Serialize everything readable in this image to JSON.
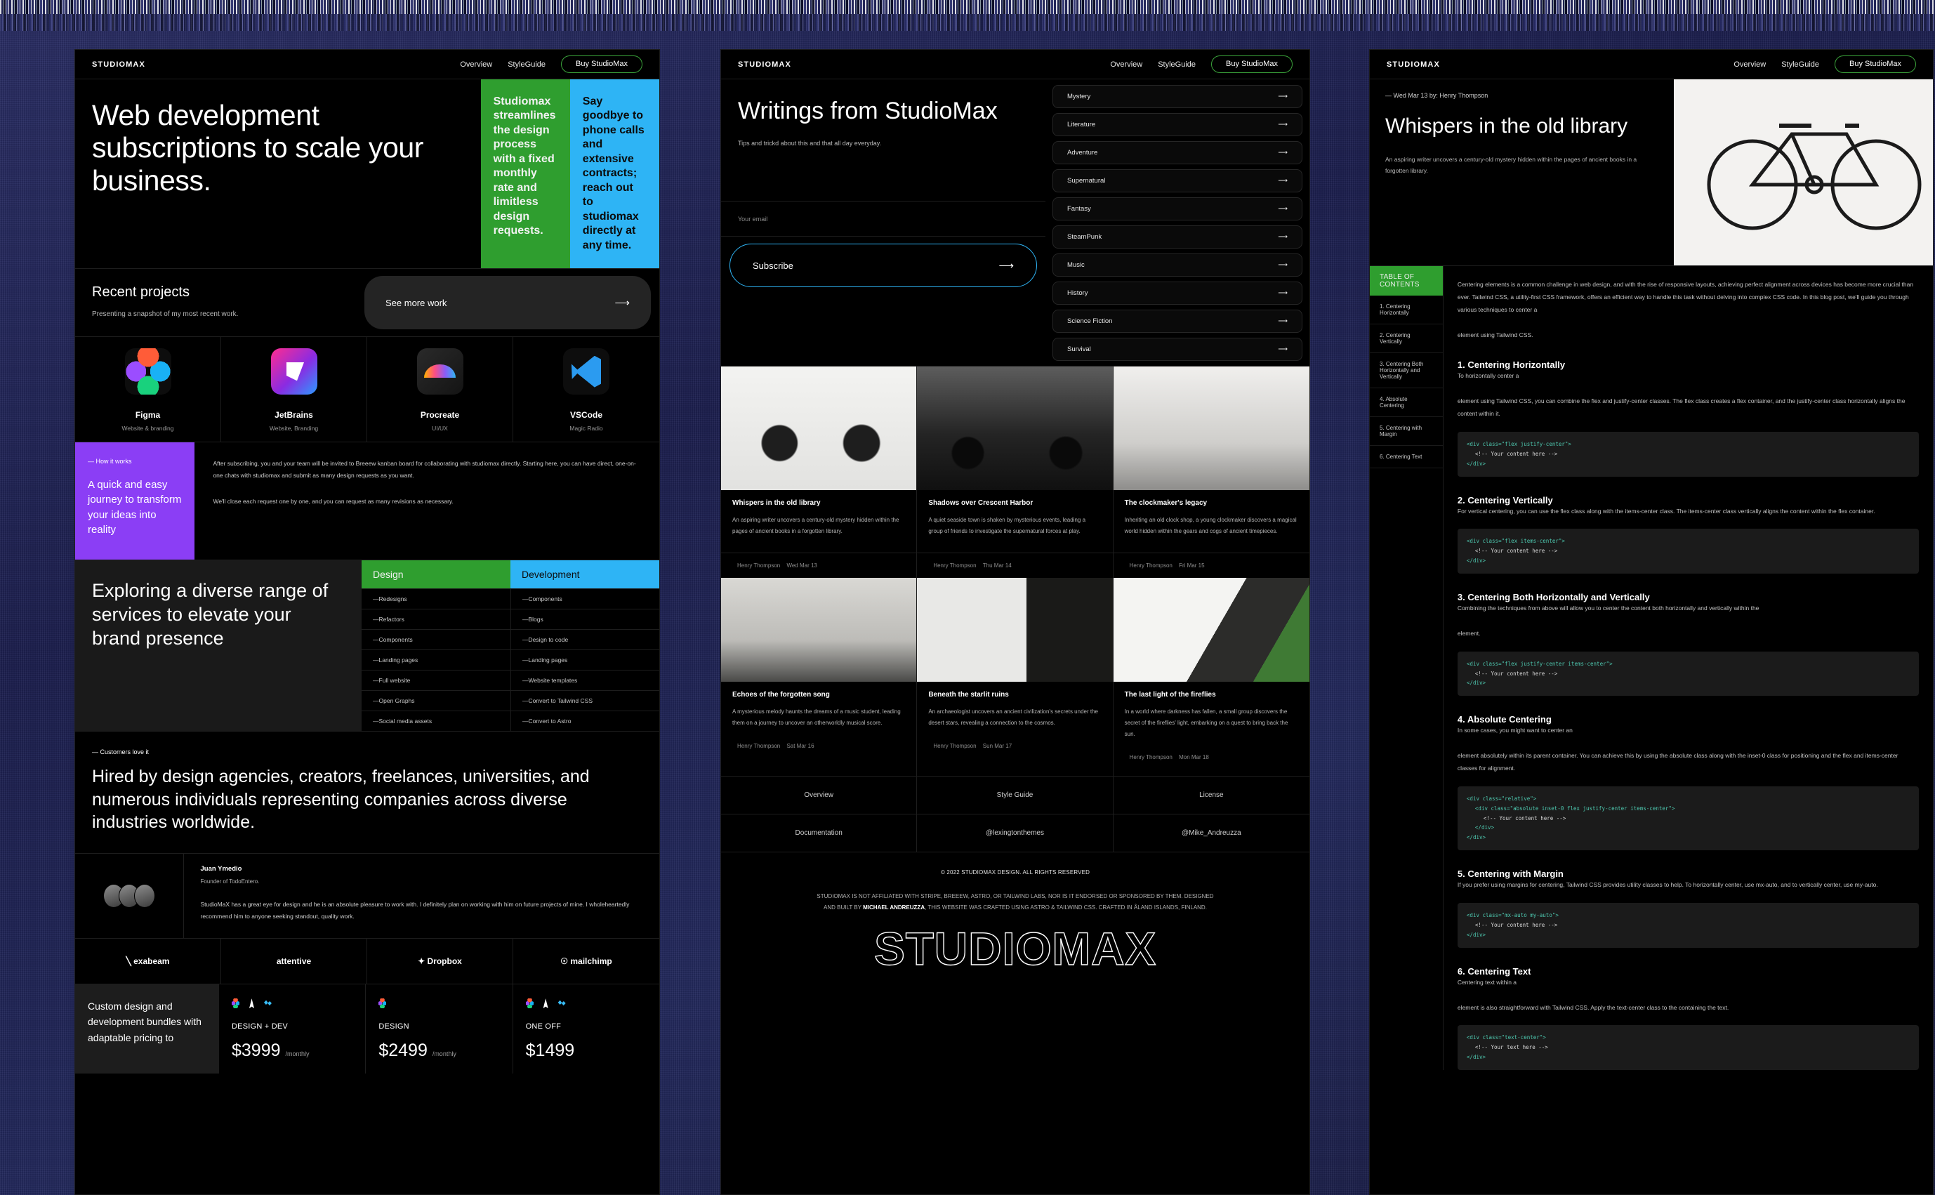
{
  "nav": {
    "brand": "STUDIOMAX",
    "links": [
      "Overview",
      "StyleGuide"
    ],
    "cta": "Buy StudioMax",
    "cta_color": "#3aa33a"
  },
  "panel1": {
    "hero": {
      "title": "Web development subscriptions to scale your business.",
      "card_green": "Studiomax streamlines the design process with a fixed monthly rate and limitless design requests.",
      "card_blue": "Say goodbye to phone calls and extensive contracts; reach out to studiomax directly at any time.",
      "green": "#2f9e2f",
      "blue": "#2eb4f5"
    },
    "recent": {
      "heading": "Recent projects",
      "sub": "Presenting a snapshot of my most recent work.",
      "cta": "See more work",
      "apps": [
        {
          "name": "Figma",
          "desc": "Website & branding",
          "icon": "figma-icon"
        },
        {
          "name": "JetBrains",
          "desc": "Website, Branding",
          "icon": "jetbrains-icon"
        },
        {
          "name": "Procreate",
          "desc": "UI/UX",
          "icon": "procreate-icon"
        },
        {
          "name": "VSCode",
          "desc": "Magic Radio",
          "icon": "vscode-icon"
        }
      ]
    },
    "how": {
      "eyebrow": "— How it works",
      "title": "A quick and easy journey to transform your ideas into reality",
      "purple": "#8b3ef5",
      "paragraphs": [
        "After subscribing, you and your team will be invited to Breeew kanban board for collaborating with studiomax directly. Starting here, you can have direct, one-on-one chats with studiomax and submit as many design requests as you want.",
        "We'll close each request one by one, and you can request as many revisions as necessary."
      ]
    },
    "services": {
      "title": "Exploring a diverse range of services to elevate your brand presence",
      "col_design": "Design",
      "col_development": "Development",
      "design_items": [
        "—Redesigns",
        "—Refactors",
        "—Components",
        "—Landing pages",
        "—Full website",
        "—Open Graphs",
        "—Social media assets"
      ],
      "dev_items": [
        "—Components",
        "—Blogs",
        "—Design to code",
        "—Landing pages",
        "—Website templates",
        "—Convert to Tailwind CSS",
        "—Convert to Astro"
      ]
    },
    "customers": {
      "eyebrow": "— Customers love it",
      "title": "Hired by design agencies, creators, freelances, universities, and numerous individuals representing companies across diverse industries worldwide."
    },
    "testimonial": {
      "name": "Juan Ymedio",
      "role": "Founder of TodoEntero.",
      "quote": "StudioMaX has a great eye for design and he is an absolute pleasure to work with. I definitely plan on working with him on future projects of mine. I wholeheartedly recommend him to anyone seeking standout, quality work."
    },
    "logos": [
      "exabeam",
      "attentive",
      "Dropbox",
      "mailchimp"
    ],
    "pricing": {
      "intro": "Custom design and development bundles with adaptable pricing to",
      "plans": [
        {
          "name": "DESIGN + DEV",
          "price": "$3999",
          "period": "/monthly",
          "icons": [
            "figma-icon",
            "astro-icon",
            "tailwind-icon"
          ]
        },
        {
          "name": "DESIGN",
          "price": "$2499",
          "period": "/monthly",
          "icons": [
            "figma-icon"
          ]
        },
        {
          "name": "ONE OFF",
          "price": "$1499",
          "period": "",
          "icons": [
            "figma-icon",
            "astro-icon",
            "tailwind-icon"
          ]
        }
      ]
    }
  },
  "panel2": {
    "title": "Writings from StudioMax",
    "sub": "Tips and trickd about this and that all day everyday.",
    "email_placeholder": "Your email",
    "subscribe": "Subscribe",
    "categories": [
      "Mystery",
      "Literature",
      "Adventure",
      "Supernatural",
      "Fantasy",
      "SteamPunk",
      "Music",
      "History",
      "Science Fiction",
      "Survival"
    ],
    "posts_row1": [
      {
        "title": "Whispers in the old library",
        "desc": "An aspiring writer uncovers a century-old mystery hidden within the pages of ancient books in a forgotten library.",
        "image": "bicycle-photo"
      },
      {
        "title": "Shadows over Crescent Harbor",
        "desc": "A quiet seaside town is shaken by mysterious events, leading a group of friends to investigate the supernatural forces at play.",
        "image": "classic-car-photo"
      },
      {
        "title": "The clockmaker's legacy",
        "desc": "Inheriting an old clock shop, a young clockmaker discovers a magical world hidden within the gears and cogs of ancient timepieces.",
        "image": "typewriter-photo"
      }
    ],
    "posts_row2": [
      {
        "author": "Henry Thompson",
        "date": "Wed Mar 13",
        "title": "Echoes of the forgotten song",
        "desc": "A mysterious melody haunts the dreams of a music student, leading them on a journey to uncover an otherworldly musical score.",
        "foot_author": "Henry Thompson",
        "foot_date": "Sat Mar 16",
        "image": "desk-mug-photo"
      },
      {
        "author": "Henry Thompson",
        "date": "Thu Mar 14",
        "title": "Beneath the starlit ruins",
        "desc": "An archaeologist uncovers an ancient civilization's secrets under the desert stars, revealing a connection to the cosmos.",
        "foot_author": "Henry Thompson",
        "foot_date": "Sun Mar 17",
        "image": "calendar-photo"
      },
      {
        "author": "Henry Thompson",
        "date": "Fri Mar 15",
        "title": "The last light of the fireflies",
        "desc": "In a world where darkness has fallen, a small group discovers the secret of the fireflies' light, embarking on a quest to bring back the sun.",
        "foot_author": "Henry Thompson",
        "foot_date": "Mon Mar 18",
        "image": "laptop-clock-photo"
      }
    ],
    "footer_links": [
      "Overview",
      "Style Guide",
      "License",
      "Documentation",
      "@lexingtonthemes",
      "@Mike_Andreuzza"
    ],
    "copyright": "© 2022 STUDIOMAX DESIGN. ALL RIGHTS RESERVED",
    "disclaimer_1": "STUDIOMAX IS NOT AFFILIATED WITH STRIPE, BREEEW, ASTRO, OR TAILWIND LABS, NOR IS IT ENDORSED OR SPONSORED BY THEM. DESIGNED",
    "disclaimer_2a": "AND BUILT BY ",
    "disclaimer_2b": "MICHAEL ANDREUZZA",
    "disclaimer_2c": ", THIS WEBSITE WAS CRAFTED USING ASTRO & TAILWIND CSS. CRAFTED IN ÅLAND ISLANDS, FINLAND.",
    "wordmark": "STUDIOMAX"
  },
  "panel3": {
    "date_author": "— Wed Mar 13 by: Henry Thompson",
    "title": "Whispers in the old library",
    "sub": "An aspiring writer uncovers a century-old mystery hidden within the pages of ancient books in a forgotten library.",
    "hero_image": "bicycle-on-wall-photo",
    "toc_head": "TABLE OF CONTENTS",
    "toc": [
      "1. Centering Horizontally",
      "2. Centering Vertically",
      "3. Centering Both Horizontally and Vertically",
      "4. Absolute Centering",
      "5. Centering with Margin",
      "6. Centering Text"
    ],
    "intro_1": "Centering elements is a common challenge in web design, and with the rise of responsive layouts, achieving perfect alignment across devices has become more crucial than ever. Tailwind CSS, a utility-first CSS framework, offers an efficient way to handle this task without delving into complex CSS code. In this blog post, we'll guide you through various techniques to center a",
    "intro_2": "element using Tailwind CSS.",
    "sections": [
      {
        "heading": "1. Centering Horizontally",
        "p1": "To horizontally center a",
        "p2": "element using Tailwind CSS, you can combine the flex and justify-center classes. The flex class creates a flex container, and the justify-center class horizontally aligns the content within it.",
        "code_open": "<div class=\"flex justify-center\">",
        "code_comment": "<!-- Your content here -->",
        "code_close": "</div>"
      },
      {
        "heading": "2. Centering Vertically",
        "p1": "For vertical centering, you can use the flex class along with the items-center class. The items-center class vertically aligns the content within the flex container.",
        "p2": "",
        "code_open": "<div class=\"flex items-center\">",
        "code_comment": "<!-- Your content here -->",
        "code_close": "</div>"
      },
      {
        "heading": "3. Centering Both Horizontally and Vertically",
        "p1": "Combining the techniques from above will allow you to center the content both horizontally and vertically within the",
        "p2": "element.",
        "code_open": "<div class=\"flex justify-center items-center\">",
        "code_comment": "<!-- Your content here -->",
        "code_close": "</div>"
      },
      {
        "heading": "4. Absolute Centering",
        "p1": "In some cases, you might want to center an",
        "p2": "element absolutely within its parent container. You can achieve this by using the absolute class along with the inset-0 class for positioning and the flex and items-center classes for alignment.",
        "code_open": "<div class=\"relative\">",
        "code_open2": "<div class=\"absolute inset-0 flex justify-center items-center\">",
        "code_comment": "<!-- Your content here -->",
        "code_close": "</div>",
        "code_close2": "</div>"
      },
      {
        "heading": "5. Centering with Margin",
        "p1": "If you prefer using margins for centering, Tailwind CSS provides utility classes to help. To horizontally center, use mx-auto, and to vertically center, use my-auto.",
        "p2": "",
        "code_open": "<div class=\"mx-auto my-auto\">",
        "code_comment": "<!-- Your content here -->",
        "code_close": "</div>"
      },
      {
        "heading": "6. Centering Text",
        "p1": "Centering text within a",
        "p2": "element is also straightforward with Tailwind CSS. Apply the text-center class to the containing the text.",
        "code_open": "<div class=\"text-center\">",
        "code_comment": "<!-- Your text here -->",
        "code_close": "</div>"
      }
    ]
  }
}
